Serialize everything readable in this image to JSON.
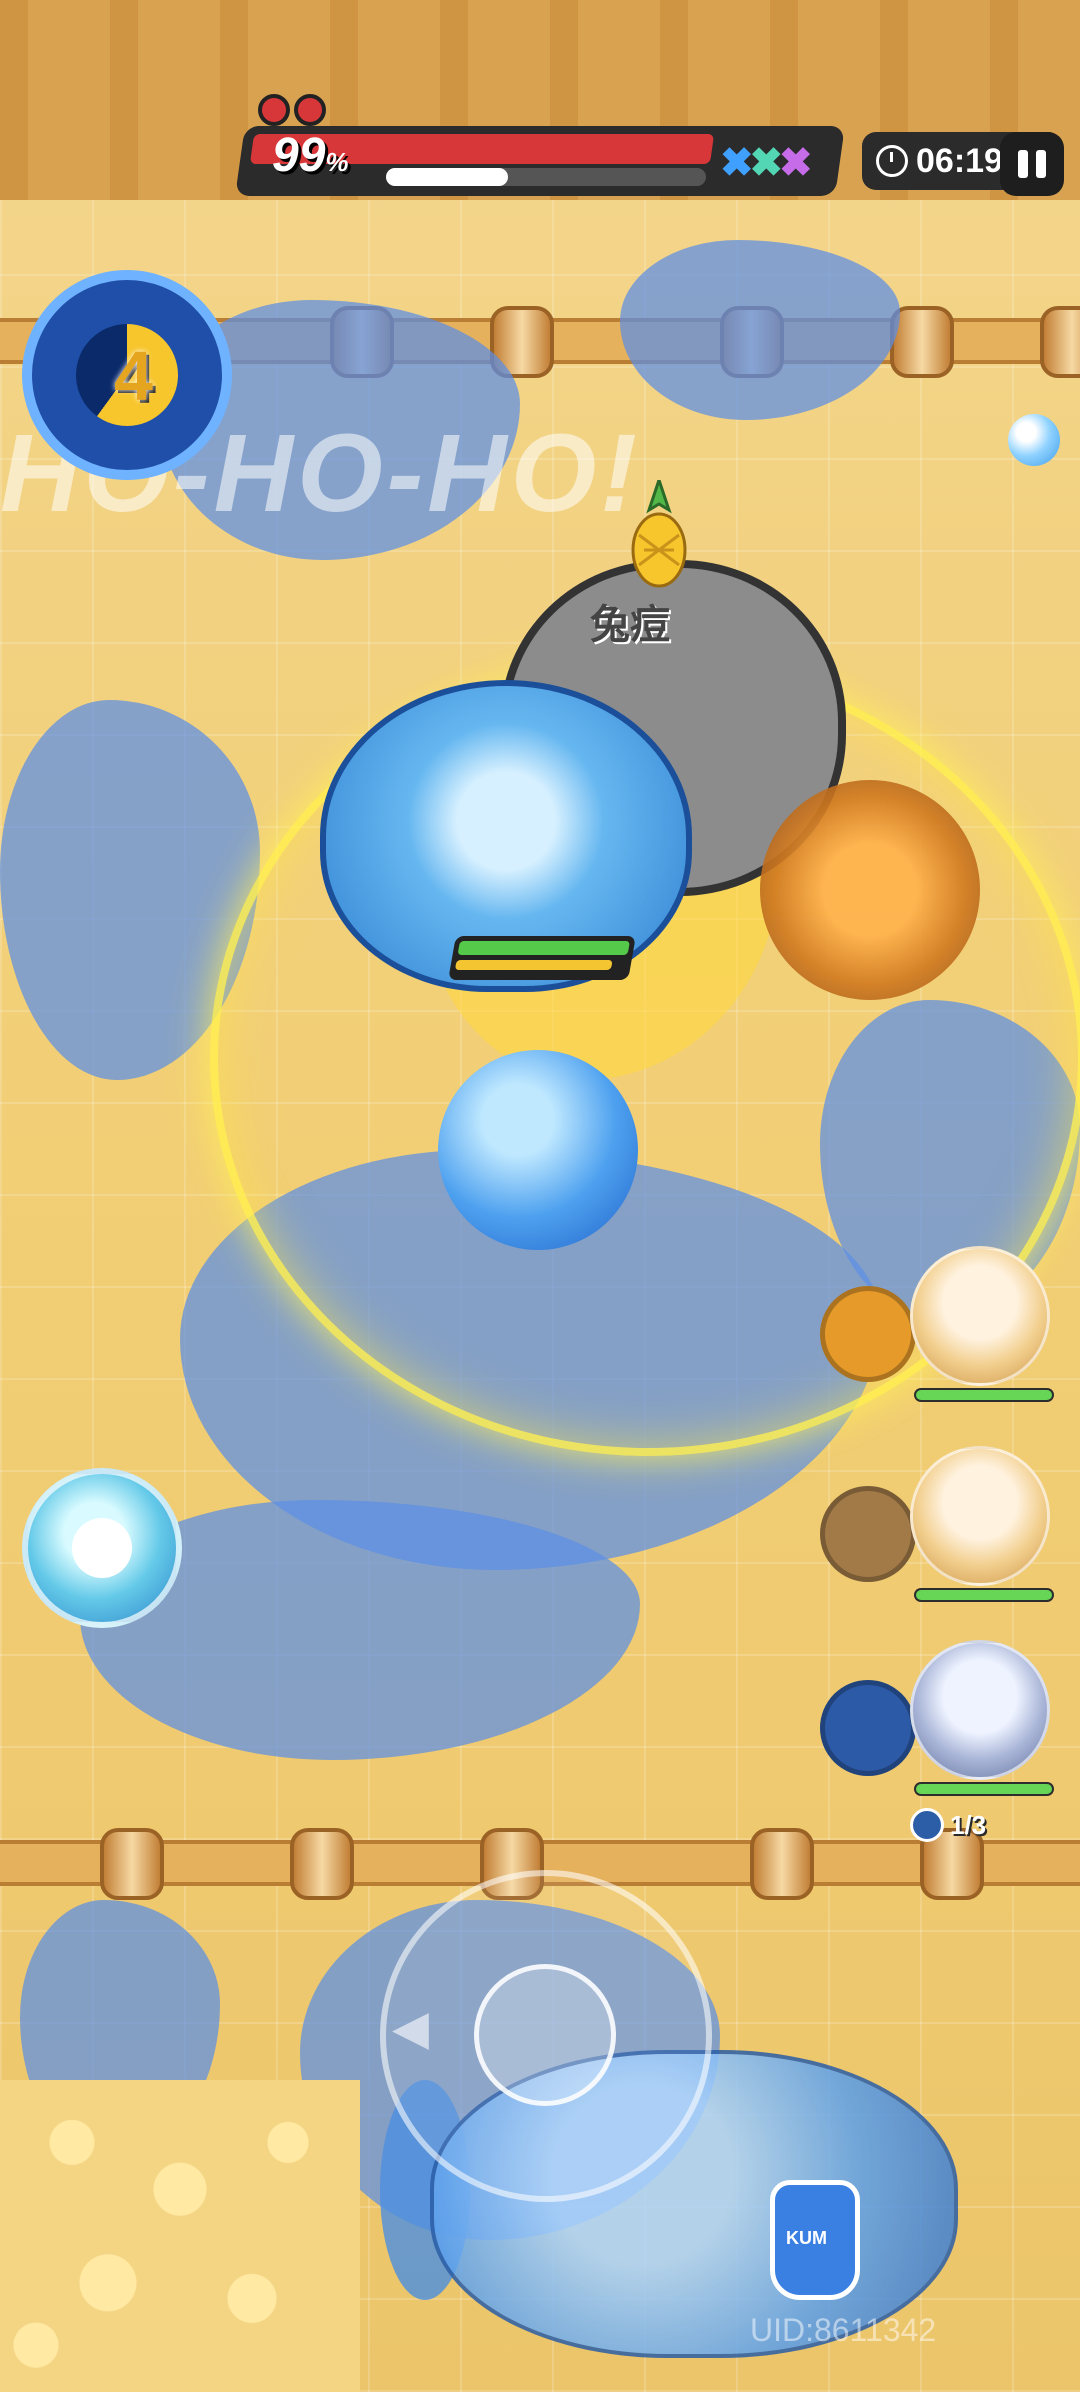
{
  "hud": {
    "hp_percent_value": "99",
    "hp_percent_sign": "%",
    "boss_hp_fraction": 0.99,
    "boss_shield_fraction": 0.38,
    "timer": "06:19",
    "crosses": "✖✖✖",
    "colors": {
      "hp": "#d8373a",
      "cross1": "#3fa0ff",
      "cross2": "#53d6b4",
      "cross3": "#c76ce9"
    }
  },
  "wave": {
    "number": "4",
    "icon": "wave-counter-icon"
  },
  "arena_text": {
    "shout": "HO-HO-HO!"
  },
  "enemy": {
    "name": "兔痘",
    "icon": "pineapple-icon"
  },
  "party": [
    {
      "slot": "party-member-1",
      "orb_color": "#e59a2a",
      "hp_fraction": 1.0
    },
    {
      "slot": "party-member-2",
      "orb_color": "#a27a47",
      "hp_fraction": 1.0
    },
    {
      "slot": "party-member-3",
      "orb_color": "#2c5aa6",
      "hp_fraction": 1.0
    }
  ],
  "charge": {
    "label": "1/3",
    "icon": "skill-charge-icon"
  },
  "potion": {
    "label": "KUM"
  },
  "footer": {
    "uid": "UID:8611342"
  }
}
